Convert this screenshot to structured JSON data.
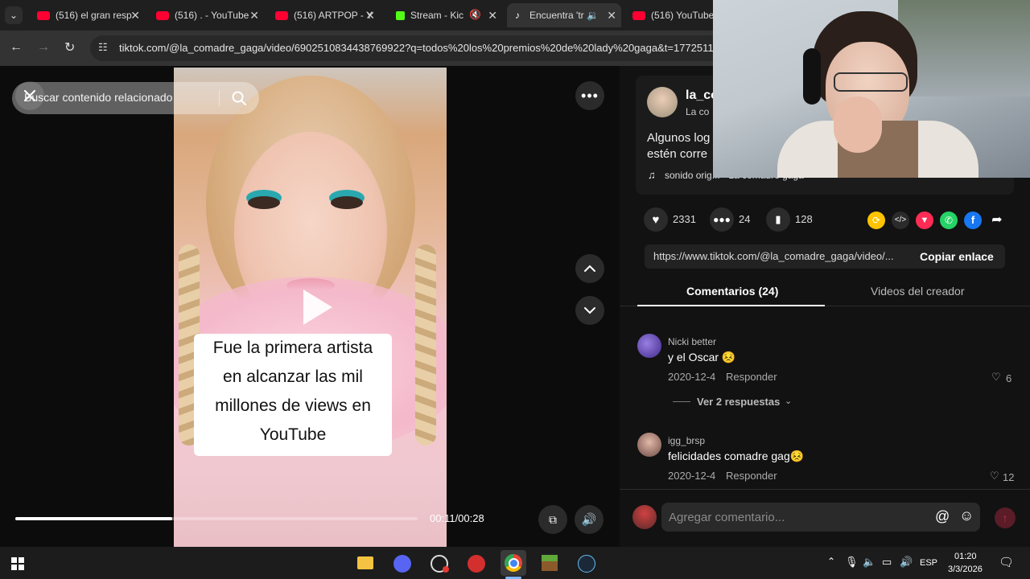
{
  "tabs": [
    {
      "title": "(516) el gran resp",
      "icon": "youtube-icon"
    },
    {
      "title": "(516) . - YouTube",
      "icon": "youtube-icon"
    },
    {
      "title": "(516) ARTPOP - Y",
      "icon": "youtube-icon"
    },
    {
      "title": "Stream - Kic",
      "icon": "kick-icon"
    },
    {
      "title": "Encuentra 'tr",
      "icon": "tiktok-icon"
    },
    {
      "title": "(516) YouTube",
      "icon": "youtube-icon"
    }
  ],
  "address": {
    "url": "tiktok.com/@la_comadre_gaga/video/6902510834438769922?q=todos%20los%20premios%20de%20lady%20gaga&t=17725117"
  },
  "video": {
    "search_placeholder": "Buscar contenido relacionado",
    "caption_lines": [
      "Fue la primera artista",
      "en alcanzar las mil",
      "millones de views en",
      "YouTube"
    ],
    "time": "00:11/00:28",
    "progress": 0.39
  },
  "author": {
    "username": "la_co",
    "nickname": "La co",
    "description_line1": "Algunos log",
    "description_line2": "estén corre",
    "sound": "sonido orig... · La comadre gaga"
  },
  "stats": {
    "likes": "2331",
    "comments": "24",
    "saves": "128"
  },
  "share": {
    "link": "https://www.tiktok.com/@la_comadre_gaga/video/...",
    "copy_label": "Copiar enlace"
  },
  "panel_tabs": {
    "comments": "Comentarios (24)",
    "creator_videos": "Videos del creador"
  },
  "comments": [
    {
      "user": "Nicki better",
      "text": "y el Oscar 😣",
      "date": "2020-12-4",
      "reply": "Responder",
      "likes": "6",
      "replies_label": "Ver 2 respuestas"
    },
    {
      "user": "igg_brsp",
      "text": "felicidades comadre gag😣",
      "date": "2020-12-4",
      "reply": "Responder",
      "likes": "12"
    }
  ],
  "comment_input": {
    "placeholder": "Agregar comentario..."
  },
  "taskbar": {
    "lang": "ESP",
    "time": "01:20",
    "date": "3/3/2026"
  },
  "colors": {
    "tiktok_red": "#fe2c55",
    "youtube_red": "#ff0033",
    "kick_green": "#53fc18"
  }
}
